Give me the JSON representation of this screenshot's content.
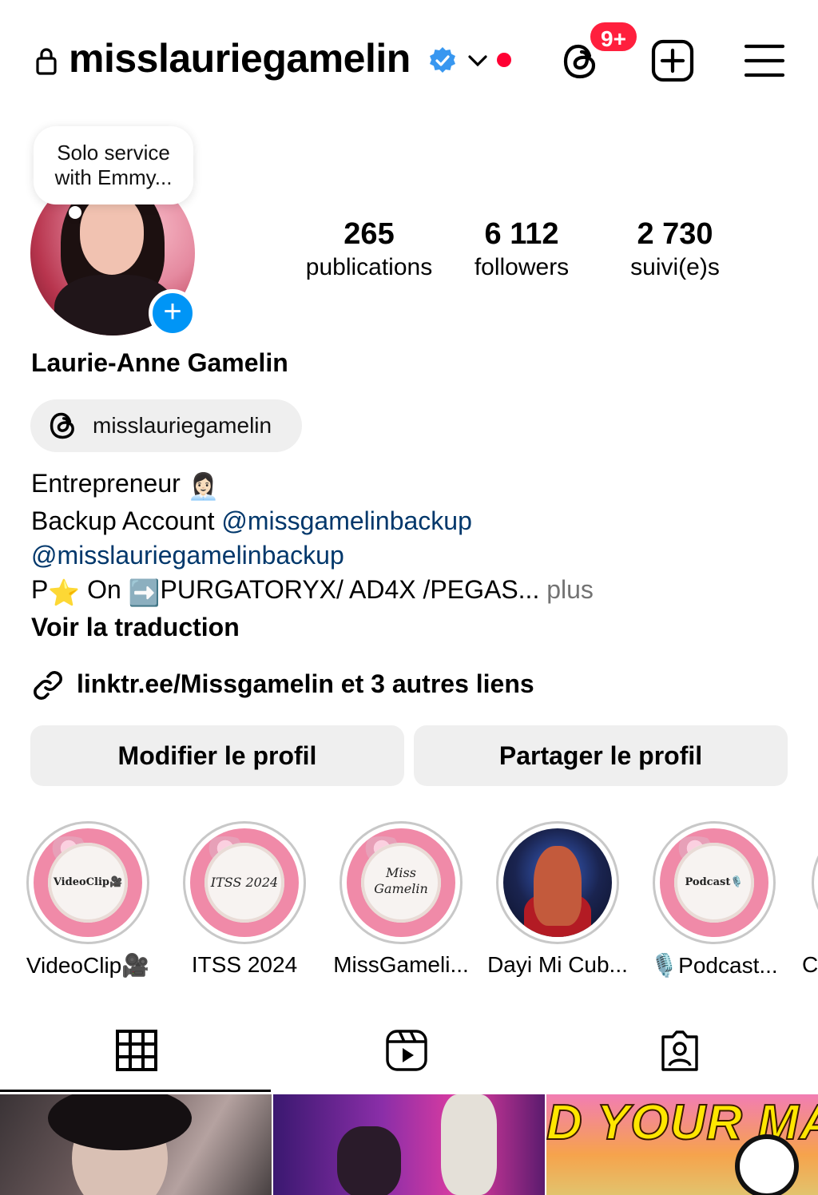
{
  "header": {
    "username": "misslauriegamelin",
    "notification_badge": "9+"
  },
  "note": {
    "text_line1": "Solo service",
    "text_line2": "with Emmy..."
  },
  "stats": [
    {
      "value": "265",
      "label": "publications"
    },
    {
      "value": "6 112",
      "label": "followers"
    },
    {
      "value": "2 730",
      "label": "suivi(e)s"
    }
  ],
  "profile": {
    "full_name": "Laurie-Anne Gamelin",
    "threads_handle": "misslauriegamelin"
  },
  "bio": {
    "line1": "Entrepreneur",
    "line1_emoji": "👩🏻‍💼",
    "line2_prefix": "Backup Account ",
    "line2_mention": "@missgamelinbackup",
    "line3_mention": "@misslauriegamelinbackup",
    "line4_a": "P",
    "line4_star": "⭐",
    "line4_b": " On ",
    "line4_arrow": "➡️",
    "line4_c": "PURGATORYX/ AD4X /PEGAS...",
    "more": " plus",
    "translate": "Voir la traduction"
  },
  "external_link": "linktr.ee/Missgamelin et 3 autres liens",
  "buttons": {
    "edit": "Modifier le profil",
    "share": "Partager le profil"
  },
  "highlights": [
    {
      "label": "VideoClip🎥",
      "cover_text": "VideoClip🎥"
    },
    {
      "label": "ITSS 2024",
      "cover_text": "ITSS 2024"
    },
    {
      "label": "MissGameli...",
      "cover_text": "Miss Gamelin"
    },
    {
      "label": "Dayi Mi Cub...",
      "cover_text": ""
    },
    {
      "label": "🎙️Podcast...",
      "cover_text": "Podcast🎙️"
    },
    {
      "label": "C",
      "cover_text": ""
    }
  ],
  "tabs": [
    "grid-icon",
    "reels-icon",
    "tagged-icon"
  ],
  "grid": [
    {
      "overlay_text": ""
    },
    {
      "overlay_text": ""
    },
    {
      "overlay_text": "D YOUR MAT"
    }
  ],
  "colors": {
    "accent_blue": "#0095f6",
    "link_blue": "#00376b",
    "badge_red": "#ff1f3d",
    "button_gray": "#efefef"
  }
}
